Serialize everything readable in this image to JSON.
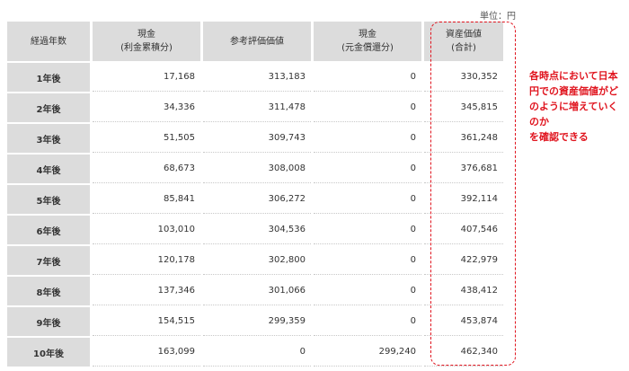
{
  "unit_label": "単位：円",
  "headers": [
    {
      "line1": "経過年数",
      "line2": ""
    },
    {
      "line1": "現金",
      "line2": "(利金累積分)"
    },
    {
      "line1": "参考評価価値",
      "line2": ""
    },
    {
      "line1": "現金",
      "line2": "(元金償還分)"
    },
    {
      "line1": "資産価値",
      "line2": "(合計)"
    }
  ],
  "rows": [
    {
      "year": "1年後",
      "cash_interest": "17,168",
      "reference_value": "313,183",
      "cash_principal": "0",
      "total": "330,352"
    },
    {
      "year": "2年後",
      "cash_interest": "34,336",
      "reference_value": "311,478",
      "cash_principal": "0",
      "total": "345,815"
    },
    {
      "year": "3年後",
      "cash_interest": "51,505",
      "reference_value": "309,743",
      "cash_principal": "0",
      "total": "361,248"
    },
    {
      "year": "4年後",
      "cash_interest": "68,673",
      "reference_value": "308,008",
      "cash_principal": "0",
      "total": "376,681"
    },
    {
      "year": "5年後",
      "cash_interest": "85,841",
      "reference_value": "306,272",
      "cash_principal": "0",
      "total": "392,114"
    },
    {
      "year": "6年後",
      "cash_interest": "103,010",
      "reference_value": "304,536",
      "cash_principal": "0",
      "total": "407,546"
    },
    {
      "year": "7年後",
      "cash_interest": "120,178",
      "reference_value": "302,800",
      "cash_principal": "0",
      "total": "422,979"
    },
    {
      "year": "8年後",
      "cash_interest": "137,346",
      "reference_value": "301,066",
      "cash_principal": "0",
      "total": "438,412"
    },
    {
      "year": "9年後",
      "cash_interest": "154,515",
      "reference_value": "299,359",
      "cash_principal": "0",
      "total": "453,874"
    },
    {
      "year": "10年後",
      "cash_interest": "163,099",
      "reference_value": "0",
      "cash_principal": "299,240",
      "total": "462,340"
    }
  ],
  "annotation": {
    "lines": [
      "各時点において日本",
      "円での資産価値がど",
      "のように増えていくのか",
      "を確認できる"
    ],
    "color": "#e0141e"
  },
  "colors": {
    "header_bg": "#dcdcdc",
    "highlight": "#e0141e"
  }
}
